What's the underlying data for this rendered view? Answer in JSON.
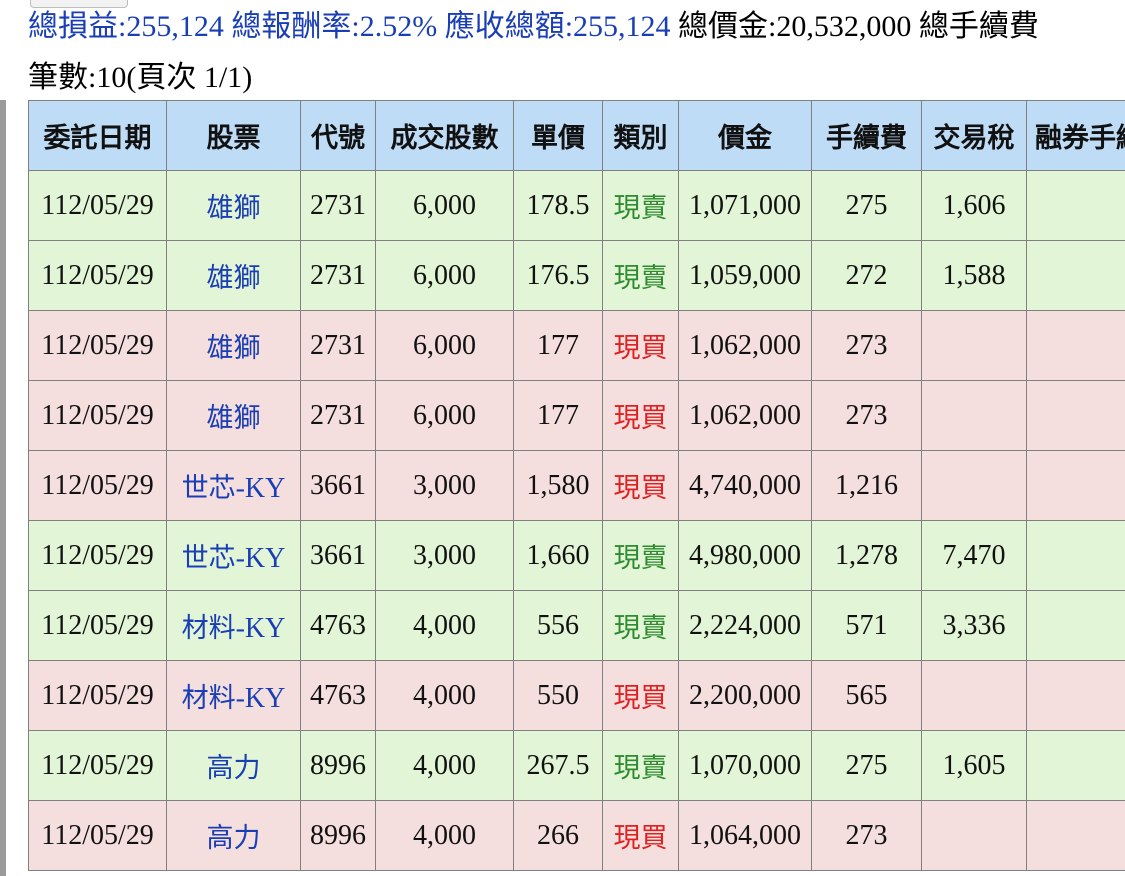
{
  "summary": {
    "profit_label": "總損益",
    "profit_value": "255,124",
    "return_label": "總報酬率",
    "return_value": "2.52%",
    "receivable_label": "應收總額",
    "receivable_value": "255,124",
    "total_price_label": "總價金",
    "total_price_value": "20,532,000",
    "total_fee_label": "總手續費"
  },
  "records": {
    "count_label": "筆數",
    "count_value": "10",
    "page_label": "頁次",
    "page_value": "1/1"
  },
  "table": {
    "headers": [
      "委託日期",
      "股票",
      "代號",
      "成交股數",
      "單價",
      "類別",
      "價金",
      "手續費",
      "交易稅",
      "融券手續費"
    ],
    "rows": [
      {
        "type": "sell",
        "date": "112/05/29",
        "stock_cjk": "雄獅",
        "stock_latin": "",
        "code": "2731",
        "shares": "6,000",
        "price": "178.5",
        "kind": "現賣",
        "amount": "1,071,000",
        "fee": "275",
        "tax": "1,606",
        "margin_fee": ""
      },
      {
        "type": "sell",
        "date": "112/05/29",
        "stock_cjk": "雄獅",
        "stock_latin": "",
        "code": "2731",
        "shares": "6,000",
        "price": "176.5",
        "kind": "現賣",
        "amount": "1,059,000",
        "fee": "272",
        "tax": "1,588",
        "margin_fee": ""
      },
      {
        "type": "buy",
        "date": "112/05/29",
        "stock_cjk": "雄獅",
        "stock_latin": "",
        "code": "2731",
        "shares": "6,000",
        "price": "177",
        "kind": "現買",
        "amount": "1,062,000",
        "fee": "273",
        "tax": "",
        "margin_fee": ""
      },
      {
        "type": "buy",
        "date": "112/05/29",
        "stock_cjk": "雄獅",
        "stock_latin": "",
        "code": "2731",
        "shares": "6,000",
        "price": "177",
        "kind": "現買",
        "amount": "1,062,000",
        "fee": "273",
        "tax": "",
        "margin_fee": ""
      },
      {
        "type": "buy",
        "date": "112/05/29",
        "stock_cjk": "世芯",
        "stock_latin": "-KY",
        "code": "3661",
        "shares": "3,000",
        "price": "1,580",
        "kind": "現買",
        "amount": "4,740,000",
        "fee": "1,216",
        "tax": "",
        "margin_fee": ""
      },
      {
        "type": "sell",
        "date": "112/05/29",
        "stock_cjk": "世芯",
        "stock_latin": "-KY",
        "code": "3661",
        "shares": "3,000",
        "price": "1,660",
        "kind": "現賣",
        "amount": "4,980,000",
        "fee": "1,278",
        "tax": "7,470",
        "margin_fee": ""
      },
      {
        "type": "sell",
        "date": "112/05/29",
        "stock_cjk": "材料",
        "stock_latin": "-KY",
        "code": "4763",
        "shares": "4,000",
        "price": "556",
        "kind": "現賣",
        "amount": "2,224,000",
        "fee": "571",
        "tax": "3,336",
        "margin_fee": ""
      },
      {
        "type": "buy",
        "date": "112/05/29",
        "stock_cjk": "材料",
        "stock_latin": "-KY",
        "code": "4763",
        "shares": "4,000",
        "price": "550",
        "kind": "現買",
        "amount": "2,200,000",
        "fee": "565",
        "tax": "",
        "margin_fee": ""
      },
      {
        "type": "sell",
        "date": "112/05/29",
        "stock_cjk": "高力",
        "stock_latin": "",
        "code": "8996",
        "shares": "4,000",
        "price": "267.5",
        "kind": "現賣",
        "amount": "1,070,000",
        "fee": "275",
        "tax": "1,605",
        "margin_fee": ""
      },
      {
        "type": "buy",
        "date": "112/05/29",
        "stock_cjk": "高力",
        "stock_latin": "",
        "code": "8996",
        "shares": "4,000",
        "price": "266",
        "kind": "現買",
        "amount": "1,064,000",
        "fee": "273",
        "tax": "",
        "margin_fee": ""
      }
    ]
  },
  "colors": {
    "header_bg": "#bfdcf7",
    "sell_row_bg": "#e3f5d7",
    "buy_row_bg": "#f5dede",
    "sell_text": "#2e8b2e",
    "buy_text": "#e02020",
    "link_blue": "#1a3fb4"
  }
}
